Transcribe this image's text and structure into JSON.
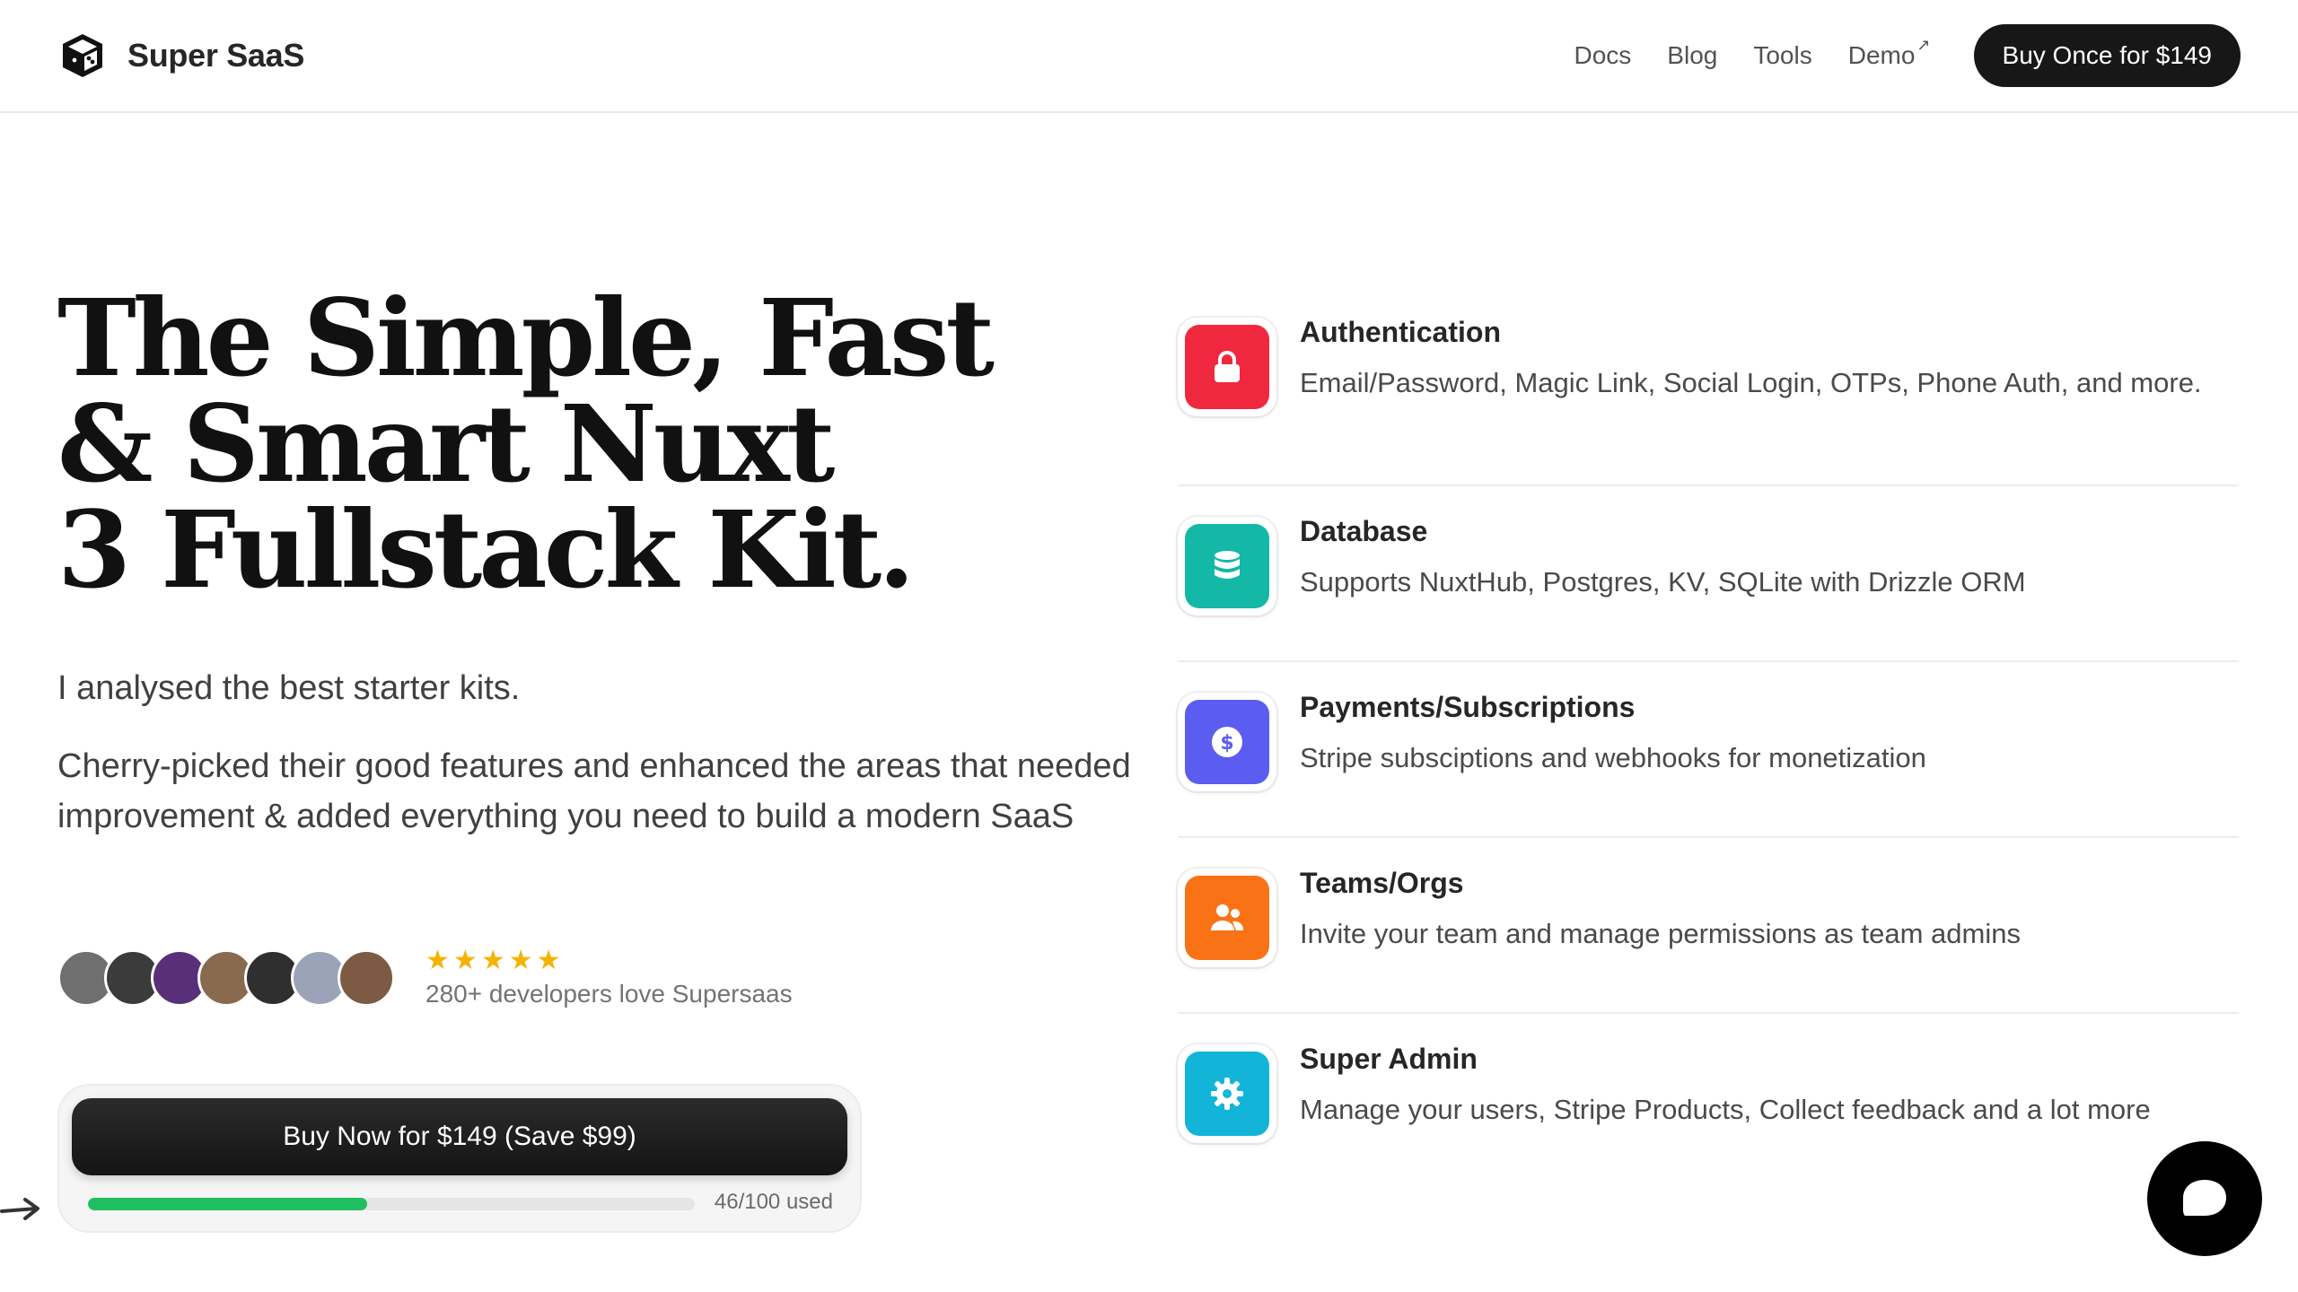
{
  "header": {
    "brand_name": "Super SaaS",
    "nav": [
      {
        "label": "Docs"
      },
      {
        "label": "Blog"
      },
      {
        "label": "Tools"
      },
      {
        "label": "Demo"
      }
    ],
    "cta_label": "Buy Once for $149"
  },
  "hero": {
    "title_lines": [
      "The Simple, Fast",
      "& Smart Nuxt",
      "3 Fullstack Kit."
    ],
    "lead": "I analysed the best starter kits.",
    "description": "Cherry-picked their good features and enhanced the areas that needed improvement & added everything you need to build a modern SaaS"
  },
  "social_proof": {
    "rating_stars": 5,
    "label": "280+ developers love Supersaas",
    "avatar_colors": [
      "#6f6f6f",
      "#3b3b3b",
      "#5a2f7a",
      "#8a6a4f",
      "#2f2f2f",
      "#9aa3b8",
      "#7c5a44"
    ]
  },
  "purchase": {
    "button_label": "Buy Now for $149 (Save $99)",
    "used": 46,
    "total": 100,
    "usage_label": "46/100 used"
  },
  "features": [
    {
      "title": "Authentication",
      "description": "Email/Password, Magic Link, Social Login, OTPs, Phone Auth, and more.",
      "icon": "lock-icon",
      "color": "#f0283f"
    },
    {
      "title": "Database",
      "description": "Supports NuxtHub, Postgres, KV, SQLite with Drizzle ORM",
      "icon": "database-icon",
      "color": "#13b8a6"
    },
    {
      "title": "Payments/Subscriptions",
      "description": "Stripe subsciptions and webhooks for monetization",
      "icon": "dollar-icon",
      "color": "#5b5cf0"
    },
    {
      "title": "Teams/Orgs",
      "description": "Invite your team and manage permissions as team admins",
      "icon": "users-icon",
      "color": "#f97316"
    },
    {
      "title": "Super Admin",
      "description": "Manage your users, Stripe Products, Collect feedback and a lot more",
      "icon": "gear-icon",
      "color": "#12b5d8"
    }
  ],
  "colors": {
    "accent_dark": "#171717",
    "progress": "#1fbf61",
    "star": "#f5b301"
  }
}
